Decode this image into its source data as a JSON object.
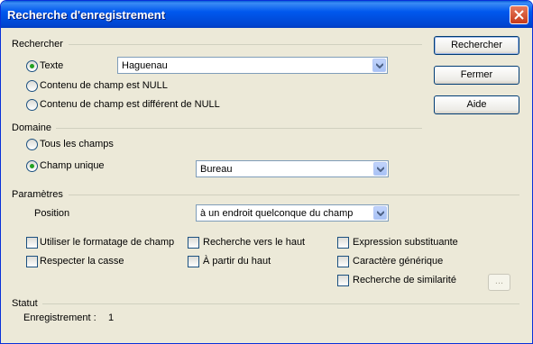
{
  "window": {
    "title": "Recherche d'enregistrement"
  },
  "search": {
    "section": "Rechercher",
    "radio_text": "Texte",
    "text_value": "Haguenau",
    "radio_null": "Contenu de champ est NULL",
    "radio_not_null": "Contenu de champ est différent de NULL"
  },
  "domain": {
    "section": "Domaine",
    "radio_all": "Tous les champs",
    "radio_single": "Champ unique",
    "field_value": "Bureau"
  },
  "params": {
    "section": "Paramètres",
    "position_label": "Position",
    "position_value": "à un endroit quelconque du champ",
    "opt_formatting": "Utiliser le formatage de champ",
    "opt_case": "Respecter la casse",
    "opt_backwards": "Recherche vers le haut",
    "opt_from_top": "À partir du haut",
    "opt_regex": "Expression substituante",
    "opt_wildcard": "Caractère générique",
    "opt_similarity": "Recherche de similarité",
    "similarity_btn": "..."
  },
  "status": {
    "section": "Statut",
    "record_label": "Enregistrement :",
    "record_value": "1"
  },
  "buttons": {
    "search": "Rechercher",
    "close": "Fermer",
    "help": "Aide"
  }
}
